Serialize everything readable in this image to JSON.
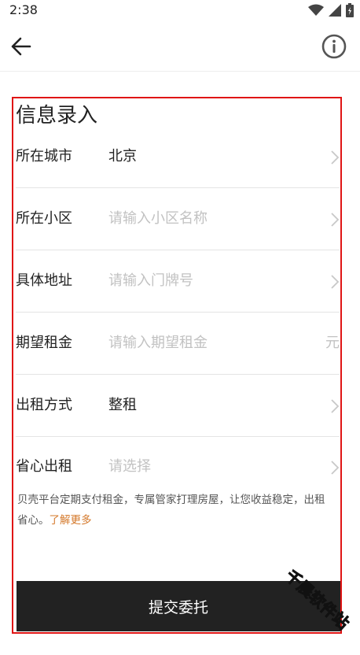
{
  "status_bar": {
    "time": "2:38",
    "icons": [
      "wifi-icon",
      "signal-icon",
      "battery-icon"
    ]
  },
  "header": {
    "back_icon": "arrow-left-icon",
    "info_icon": "info-circle-icon"
  },
  "form": {
    "title": "信息录入",
    "rows": [
      {
        "label": "所在城市",
        "value": "北京",
        "placeholder": "",
        "trailing": "chevron-right-icon"
      },
      {
        "label": "所在小区",
        "value": "",
        "placeholder": "请输入小区名称",
        "trailing": "chevron-right-icon"
      },
      {
        "label": "具体地址",
        "value": "",
        "placeholder": "请输入门牌号",
        "trailing": "chevron-right-icon"
      },
      {
        "label": "期望租金",
        "value": "",
        "placeholder": "请输入期望租金",
        "unit": "元"
      },
      {
        "label": "出租方式",
        "value": "整租",
        "placeholder": "",
        "trailing": "chevron-right-icon"
      },
      {
        "label": "省心出租",
        "value": "",
        "placeholder": "请选择",
        "trailing": "chevron-right-icon"
      }
    ],
    "note_text": "贝壳平台定期支付租金，专属管家打理房屋，让您收益稳定，出租省心。",
    "note_link": "了解更多"
  },
  "submit_label": "提交委托",
  "watermark": "千晨软件站",
  "colors": {
    "highlight_border": "#e01515",
    "link": "#d4782a",
    "button_bg": "#222222",
    "placeholder": "#c2c2c2"
  }
}
